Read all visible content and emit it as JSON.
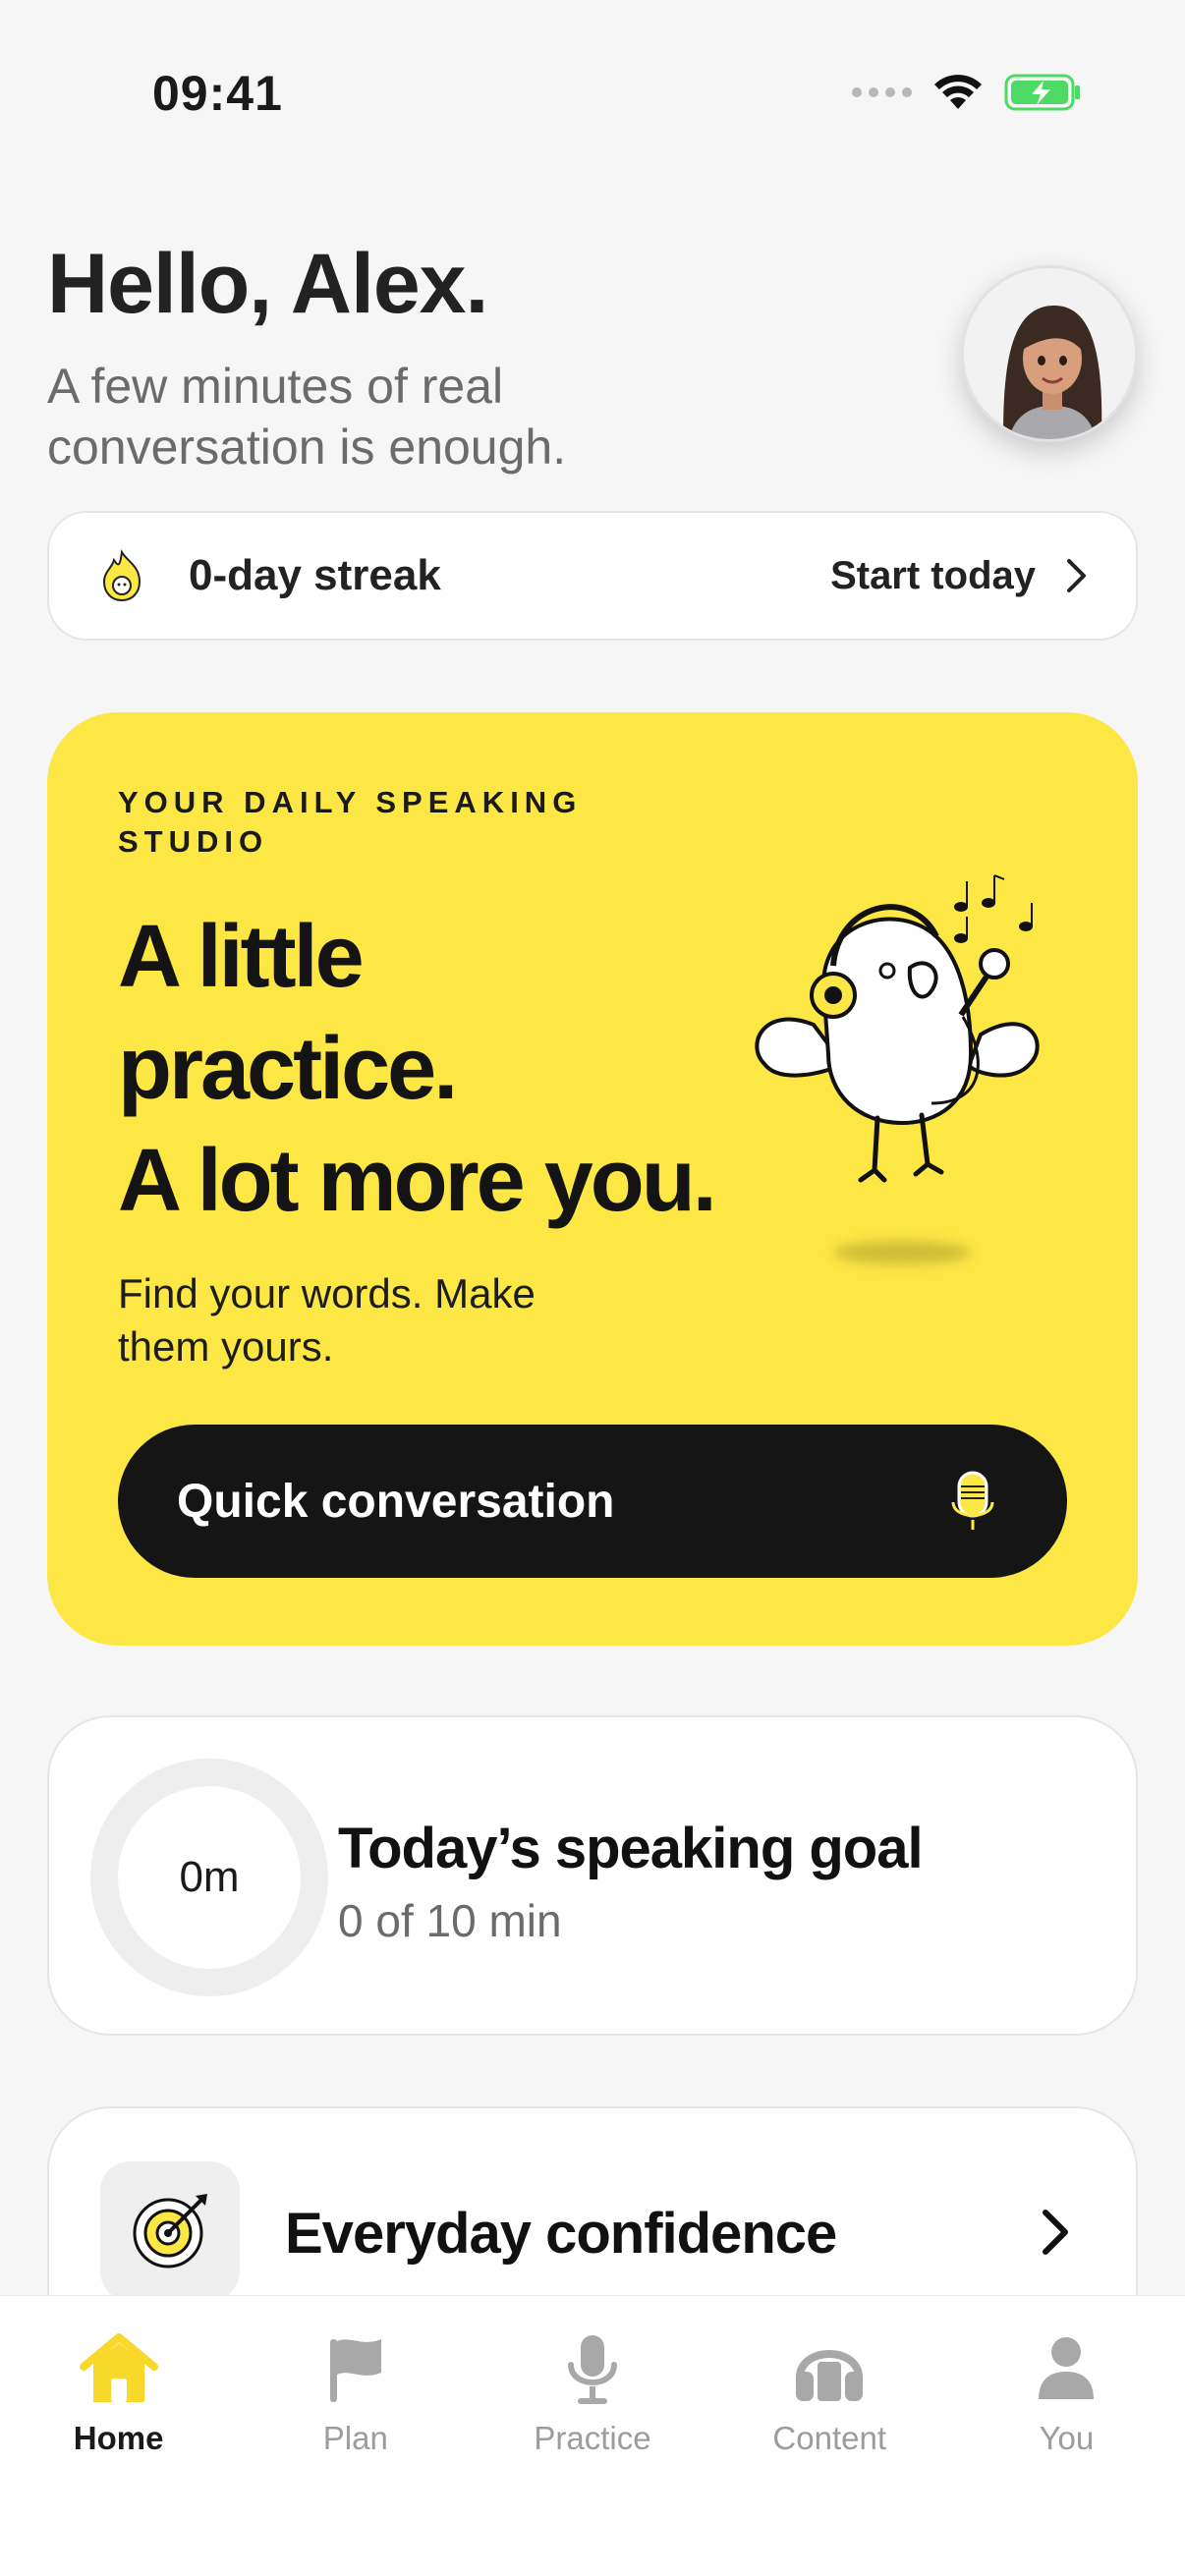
{
  "status_bar": {
    "time": "09:41"
  },
  "header": {
    "greeting": "Hello, Alex.",
    "subtitle": "A few minutes of real conversation is enough."
  },
  "streak": {
    "label": "0-day streak",
    "cta": "Start today"
  },
  "hero": {
    "eyebrow": "YOUR DAILY SPEAKING STUDIO",
    "title_line1": "A little",
    "title_line2": "practice.",
    "title_line3": "A lot more you.",
    "subtitle": "Find your words. Make them yours.",
    "button_label": "Quick conversation",
    "background_color": "#fde745"
  },
  "goal": {
    "progress_value": "0m",
    "progress_fraction": 0,
    "title": "Today’s speaking goal",
    "subtitle": "0 of 10 min"
  },
  "lesson": {
    "title": "Everyday confidence"
  },
  "tabs": [
    {
      "label": "Home",
      "icon": "home-icon",
      "active": true
    },
    {
      "label": "Plan",
      "icon": "flag-icon",
      "active": false
    },
    {
      "label": "Practice",
      "icon": "microphone-icon",
      "active": false
    },
    {
      "label": "Content",
      "icon": "headphones-icon",
      "active": false
    },
    {
      "label": "You",
      "icon": "person-icon",
      "active": false
    }
  ],
  "colors": {
    "accent_yellow": "#fde745",
    "active_tab_icon": "#f8d82a",
    "inactive_tab": "#9c9c9c",
    "battery_green": "#4cd964"
  }
}
